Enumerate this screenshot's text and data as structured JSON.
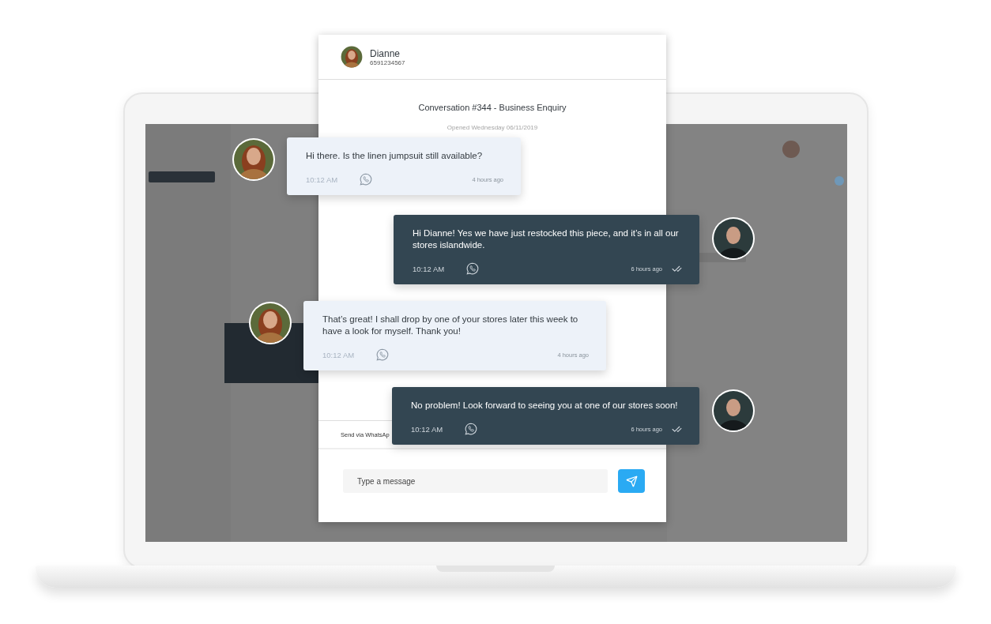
{
  "contact": {
    "name": "Dianne",
    "phone": "6591234567"
  },
  "conversation": {
    "title": "Conversation #344 - Business Enquiry",
    "opened": "Opened Wednesday 06/11/2019"
  },
  "messages": [
    {
      "kind": "incoming",
      "text": "Hi there. Is the linen jumpsuit still available?",
      "time": "10:12 AM",
      "ago": "4 hours ago"
    },
    {
      "kind": "outgoing",
      "text": "Hi Dianne! Yes we have just restocked this piece, and it’s in all our stores islandwide.",
      "time": "10:12 AM",
      "ago": "6 hours ago"
    },
    {
      "kind": "incoming",
      "text": "That’s great! I shall drop by one of your stores later this week to have a look for myself. Thank you!",
      "time": "10:12 AM",
      "ago": "4 hours ago"
    },
    {
      "kind": "outgoing",
      "text": "No problem! Look forward to seeing you at one of our stores soon!",
      "time": "10:12 AM",
      "ago": "6 hours ago"
    }
  ],
  "composer": {
    "channel": "Send via WhatsAp",
    "placeholder": "Type a message"
  }
}
